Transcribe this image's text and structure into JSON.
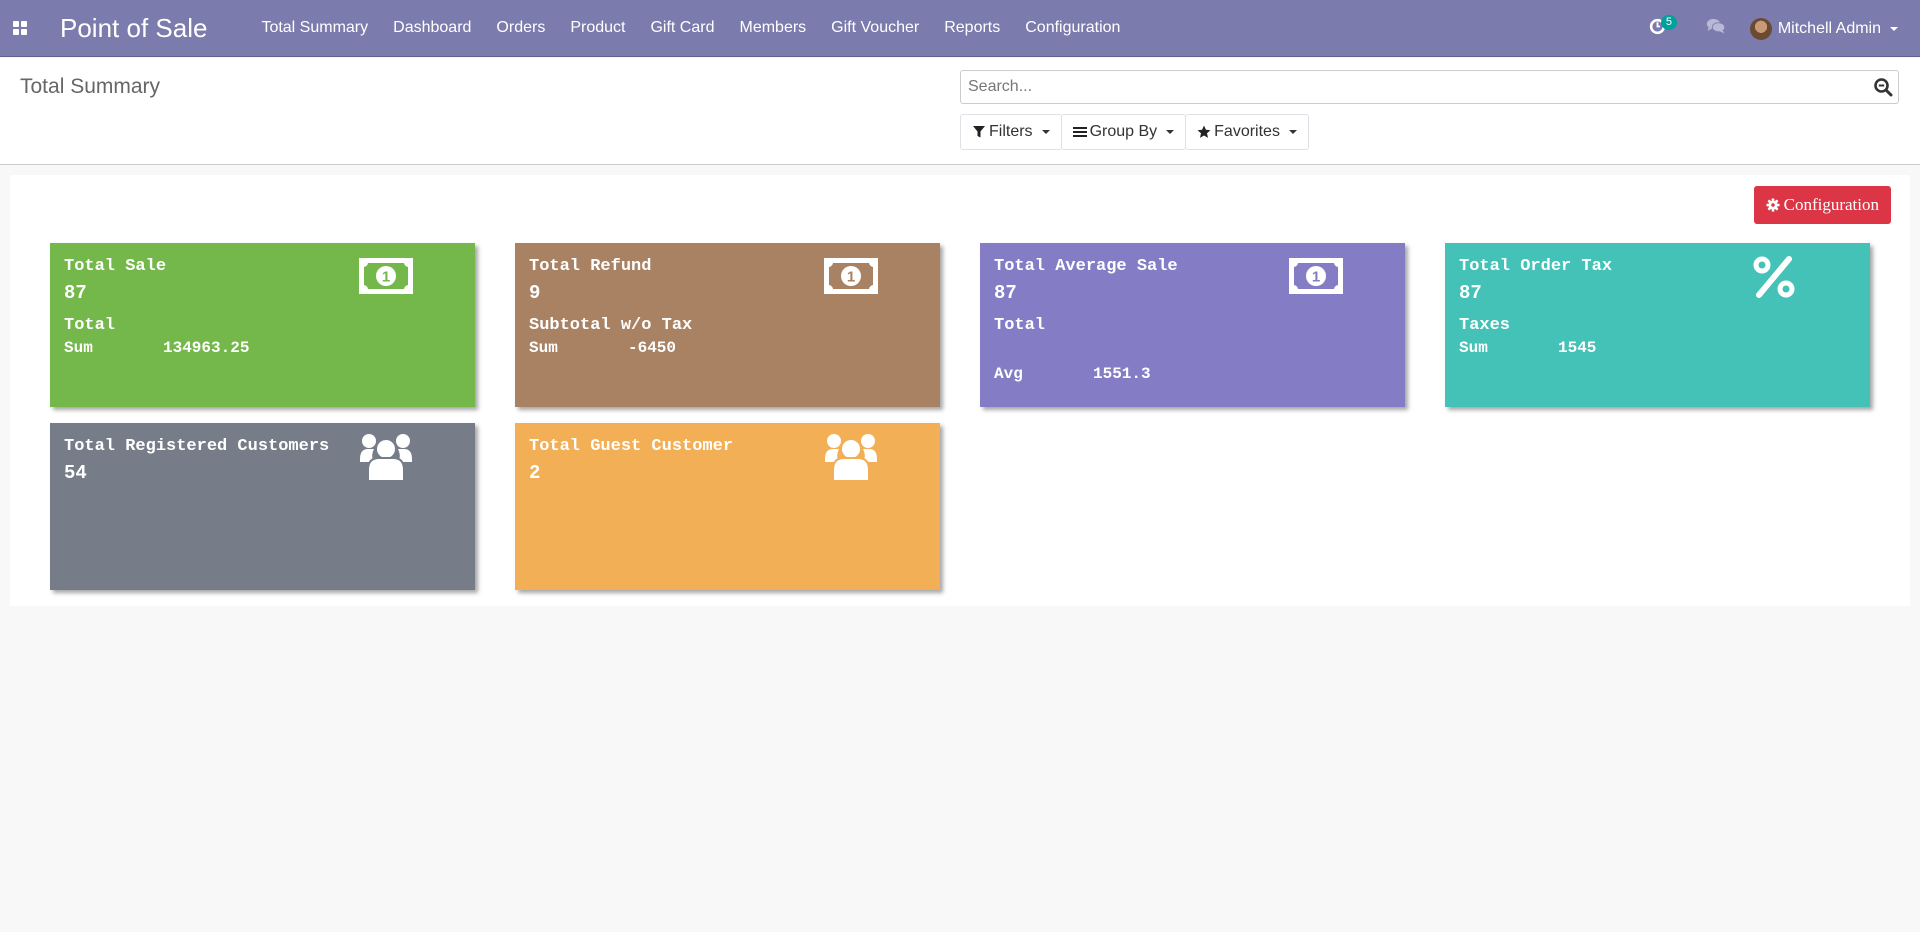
{
  "navbar": {
    "app_title": "Point of Sale",
    "menu": [
      {
        "label": "Total Summary"
      },
      {
        "label": "Dashboard"
      },
      {
        "label": "Orders"
      },
      {
        "label": "Product"
      },
      {
        "label": "Gift Card"
      },
      {
        "label": "Members"
      },
      {
        "label": "Gift Voucher"
      },
      {
        "label": "Reports"
      },
      {
        "label": "Configuration"
      }
    ],
    "activity_count": "5",
    "user_name": "Mitchell Admin",
    "icons": {
      "apps": "apps-grid-icon",
      "activity": "clock-icon",
      "chat": "comments-icon"
    },
    "color": "#7c7bad"
  },
  "control_panel": {
    "title": "Total Summary",
    "search_placeholder": "Search...",
    "search_value": "",
    "filters_label": "Filters",
    "group_by_label": "Group By",
    "favorites_label": "Favorites"
  },
  "content": {
    "config_button_label": "Configuration",
    "cards": [
      {
        "title": "Total Sale",
        "count": "87",
        "sub_label": "Total",
        "row_label": "Sum",
        "row_value": "134963.25",
        "icon": "money-bill-icon",
        "color": "#74b74a"
      },
      {
        "title": "Total Refund",
        "count": "9",
        "sub_label": "Subtotal w/o Tax",
        "row_label": "Sum",
        "row_value": "-6450",
        "icon": "money-bill-icon",
        "color": "#a98264"
      },
      {
        "title": "Total Average Sale",
        "count": "87",
        "sub_label": "Total",
        "row_label": "Avg",
        "row_value": "1551.3",
        "icon": "money-bill-icon",
        "color": "#847cc5"
      },
      {
        "title": "Total Order Tax",
        "count": "87",
        "sub_label": "Taxes",
        "row_label": "Sum",
        "row_value": "1545",
        "icon": "percent-icon",
        "color": "#44c2b7"
      },
      {
        "title": "Total Registered Customers",
        "count": "54",
        "icon": "users-icon",
        "color": "#767d88"
      },
      {
        "title": "Total Guest Customer",
        "count": "2",
        "icon": "users-icon",
        "color": "#f2af55"
      }
    ]
  },
  "colors": {
    "danger": "#dc3545",
    "badge": "#00a09d"
  }
}
